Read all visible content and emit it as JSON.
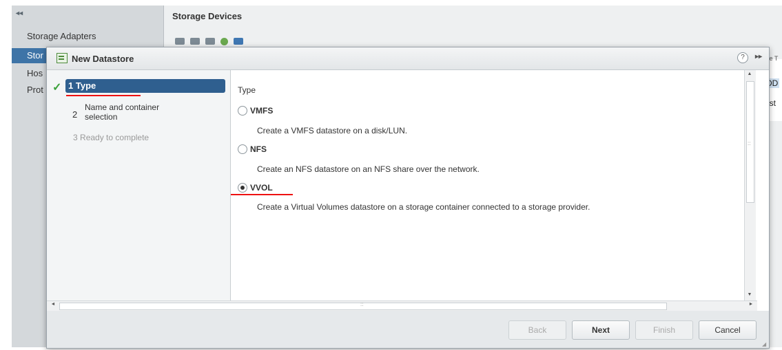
{
  "background": {
    "collapse_glyph": "◂◂",
    "nav_items": [
      "Storage Adapters",
      "Stor",
      "Hos",
      "Prot"
    ],
    "right_title": "Storage Devices",
    "table_header": "ve T",
    "cells": [
      "DD",
      "ast"
    ]
  },
  "dialog": {
    "title": "New Datastore",
    "title_icon": "datastore-icon",
    "help_glyph": "?",
    "expand_glyph": "▸▸"
  },
  "steps": {
    "check_glyph": "✓",
    "items": [
      {
        "num": "1",
        "label": "Type"
      },
      {
        "num": "2",
        "label_line1": "Name and container",
        "label_line2": "selection"
      },
      {
        "num": "3",
        "label": "Ready to complete"
      }
    ]
  },
  "content": {
    "heading": "Type",
    "options": [
      {
        "label": "VMFS",
        "desc": "Create a VMFS datastore on a disk/LUN.",
        "checked": false
      },
      {
        "label": "NFS",
        "desc": "Create an NFS datastore on an NFS share over the network.",
        "checked": false
      },
      {
        "label": "VVOL",
        "desc": "Create a Virtual Volumes datastore on a storage container connected to a storage provider.",
        "checked": true
      }
    ]
  },
  "scroll": {
    "up": "▲",
    "down": "▼",
    "left": "◄",
    "right": "►",
    "grip_v": "::",
    "grip_h": "::"
  },
  "footer": {
    "back": "Back",
    "next": "Next",
    "finish": "Finish",
    "cancel": "Cancel"
  },
  "colors": {
    "selected_step": "#2f5f8f",
    "annotation_red": "#e11111",
    "check_green": "#3aa13a"
  }
}
